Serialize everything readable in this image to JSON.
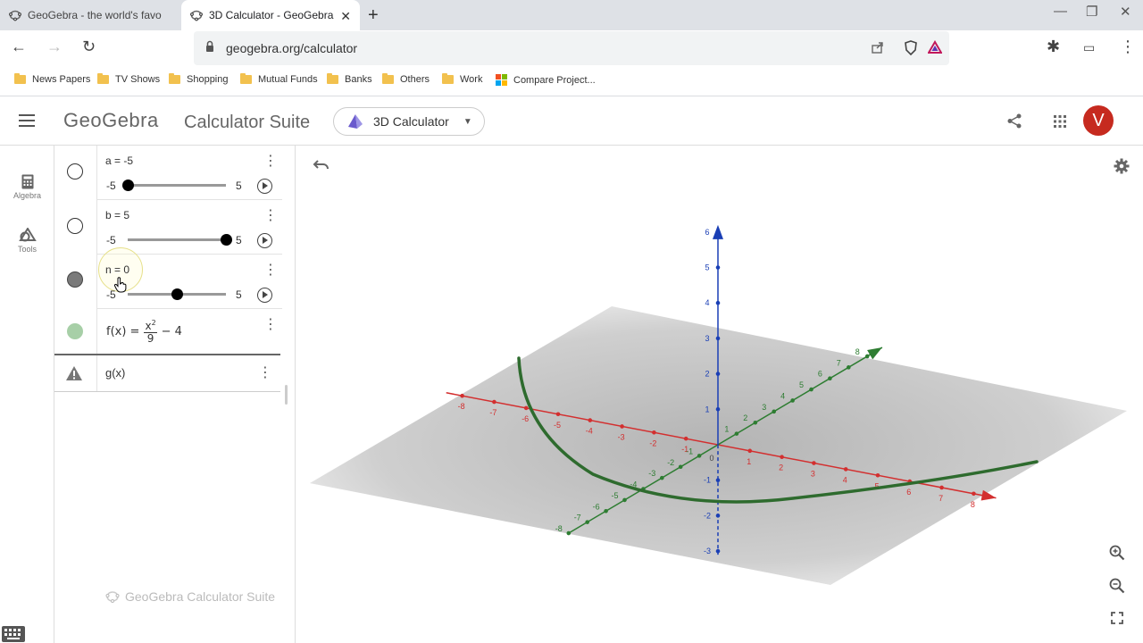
{
  "browser": {
    "tabs": [
      {
        "label": "GeoGebra - the world's favorite, free m",
        "active": false
      },
      {
        "label": "3D Calculator - GeoGebra",
        "active": true
      }
    ],
    "url": "geogebra.org/calculator",
    "bookmarks": [
      "News Papers",
      "TV Shows",
      "Shopping",
      "Mutual Funds",
      "Banks",
      "Others",
      "Work",
      "Compare Project..."
    ]
  },
  "app": {
    "logo": "GeoGebra",
    "suite_title": "Calculator Suite",
    "calculator": "3D Calculator",
    "avatar_letter": "V",
    "rail": [
      "Algebra",
      "Tools"
    ],
    "footer": "GeoGebra Calculator Suite"
  },
  "algebra": {
    "sliders": [
      {
        "name": "a",
        "eq": "a = -5",
        "min": "-5",
        "max": "5",
        "value": -5
      },
      {
        "name": "b",
        "eq": "b = 5",
        "min": "-5",
        "max": "5",
        "value": 5
      },
      {
        "name": "n",
        "eq": "n = 0",
        "min": "-5",
        "max": "5",
        "value": 0
      }
    ],
    "f_lhs": "f(x) =",
    "f_num": "x",
    "f_exp": "2",
    "f_den": "9",
    "f_tail": "− 4",
    "g": "g(x)"
  },
  "graphics": {
    "x_axis_color": "#d32f2f",
    "y_axis_color": "#2e7d32",
    "z_axis_color": "#1a3fb5",
    "curve_color": "#2e6b2e",
    "x_ticks": [
      "-8",
      "-7",
      "-6",
      "-5",
      "-4",
      "-3",
      "-2",
      "-1",
      "1",
      "2",
      "3",
      "4",
      "5",
      "6",
      "7",
      "8"
    ],
    "y_ticks": [
      "-8",
      "-7",
      "-6",
      "-5",
      "-4",
      "-3",
      "-2",
      "-1",
      "1",
      "2",
      "3",
      "4",
      "5",
      "6",
      "7",
      "8"
    ],
    "z_ticks": [
      "-3",
      "-2",
      "-1",
      "1",
      "2",
      "3",
      "4",
      "5",
      "6"
    ],
    "origin": "0"
  }
}
